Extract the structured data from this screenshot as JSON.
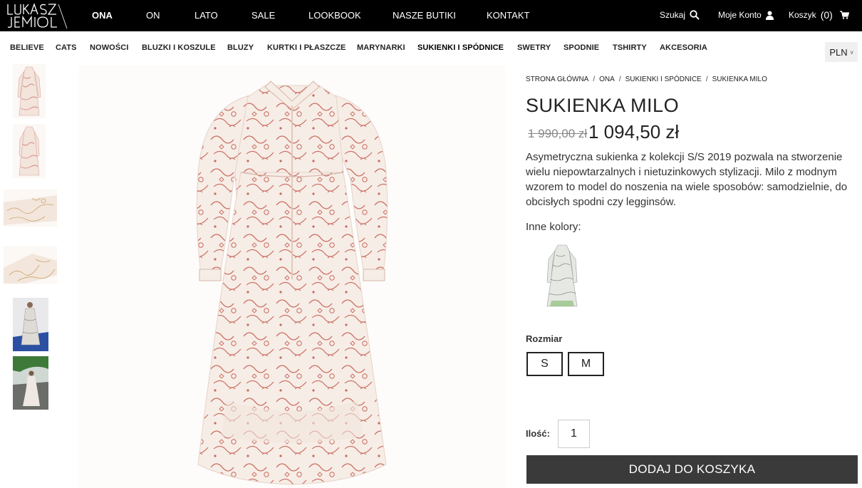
{
  "brand": {
    "logo_text": "LUKASZ JEMIOL"
  },
  "main_nav": [
    {
      "label": "ONA",
      "active": true
    },
    {
      "label": "ON",
      "active": false
    },
    {
      "label": "LATO",
      "active": false
    },
    {
      "label": "SALE",
      "active": false
    },
    {
      "label": "LOOKBOOK",
      "active": false
    },
    {
      "label": "NASZE BUTIKI",
      "active": false
    },
    {
      "label": "KONTAKT",
      "active": false
    }
  ],
  "top_right": {
    "search_label": "Szukaj",
    "search_icon": "search-icon",
    "account_label": "Moje Konto",
    "account_icon": "user-icon",
    "cart_label": "Koszyk",
    "cart_count": "(0)",
    "cart_icon": "cart-icon"
  },
  "categories": [
    {
      "label": "BELIEVE",
      "active": false
    },
    {
      "label": "CATS",
      "active": false
    },
    {
      "label": "NOWOŚCI",
      "active": false
    },
    {
      "label": "BLUZKI I KOSZULE",
      "active": false
    },
    {
      "label": "BLUZY",
      "active": false
    },
    {
      "label": "KURTKI I PŁASZCZE",
      "active": false
    },
    {
      "label": "MARYNARKI",
      "active": false
    },
    {
      "label": "SUKIENKI I SPÓDNICE",
      "active": true
    },
    {
      "label": "SWETRY",
      "active": false
    },
    {
      "label": "SPODNIE",
      "active": false
    },
    {
      "label": "TSHIRTY",
      "active": false
    },
    {
      "label": "AKCESORIA",
      "active": false
    }
  ],
  "currency": {
    "value": "PLN",
    "chevron": "v"
  },
  "breadcrumb": [
    "STRONA GŁÓWNA",
    "ONA",
    "SUKIENKI I SPÓDNICE",
    "SUKIENKA MILO"
  ],
  "breadcrumb_sep": "/",
  "product": {
    "title": "SUKIENKA MILO",
    "price_old": "1 990,00 zł",
    "price_new": "1 094,50 zł",
    "description": "Asymetryczna sukienka z kolekcji S/S 2019 pozwala na stworzenie wielu niepowtarzalnych i nietuzinkowych stylizacji. Milo z modnym wzorem to model do noszenia na wiele sposobów: samodzielnie, do obcisłych spodni czy legginsów.",
    "other_colors_label": "Inne kolory:",
    "size_label": "Rozmiar",
    "sizes": [
      "S",
      "M"
    ],
    "qty_label": "Ilość:",
    "qty_value": "1",
    "add_to_cart": "DODAJ DO KOSZYKA"
  },
  "colors": {
    "topbar_bg": "#000000",
    "button_bg": "#3a3a3a",
    "pattern_red": "#c96a5e",
    "fabric_cream": "#f6ede6"
  }
}
